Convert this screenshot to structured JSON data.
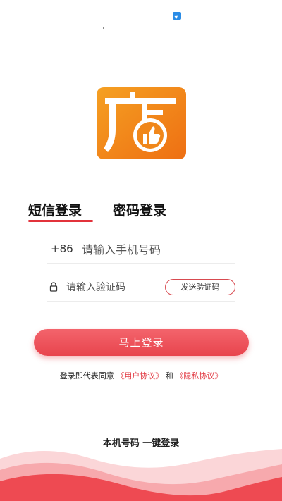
{
  "tabs": {
    "sms_label": "短信登录",
    "password_label": "密码登录",
    "active": "sms"
  },
  "phone": {
    "country_code": "+86",
    "placeholder": "请输入手机号码",
    "value": ""
  },
  "code": {
    "placeholder": "请输入验证码",
    "value": "",
    "send_label": "发送验证码"
  },
  "login": {
    "label": "马上登录"
  },
  "agreement": {
    "prefix": "登录即代表同意",
    "user_link": "《用户协议》",
    "and": "和",
    "privacy_link": "《隐私协议》"
  },
  "one_click_label": "本机号码 一键登录",
  "icons": {
    "logo": "store-logo",
    "lock": "lock-icon",
    "status": "notification-icon"
  },
  "colors": {
    "accent": "#e2323b",
    "logo_orange": "#f08a1c",
    "wave_light": "#fbd6d8",
    "wave_dark": "#ee4a52"
  }
}
